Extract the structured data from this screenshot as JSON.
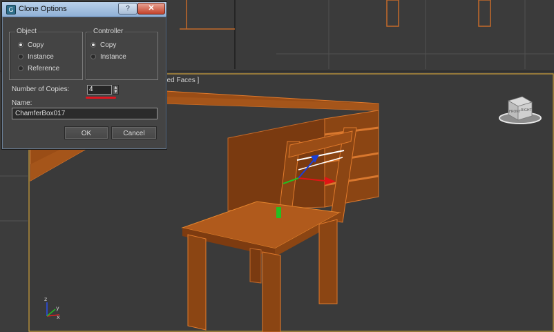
{
  "dialog": {
    "title": "Clone Options",
    "help_label": "?",
    "close_label": "✕",
    "object_group": {
      "label": "Object",
      "options": [
        {
          "label": "Copy",
          "selected": true
        },
        {
          "label": "Instance",
          "selected": false
        },
        {
          "label": "Reference",
          "selected": false
        }
      ]
    },
    "controller_group": {
      "label": "Controller",
      "options": [
        {
          "label": "Copy",
          "selected": true
        },
        {
          "label": "Instance",
          "selected": false
        }
      ]
    },
    "copies_label": "Number of Copies:",
    "copies_value": "4",
    "name_label": "Name:",
    "name_value": "ChamferBox017",
    "ok_label": "OK",
    "cancel_label": "Cancel"
  },
  "viewport": {
    "label_fragment": "ged Faces ]",
    "viewcube_labels": {
      "front": "FRONT",
      "right": "RIGHT"
    },
    "axis_labels": {
      "z": "z",
      "x": "x",
      "y": "y"
    },
    "accent_color": "#cc6e2c",
    "highlight_color": "#e0151f"
  }
}
